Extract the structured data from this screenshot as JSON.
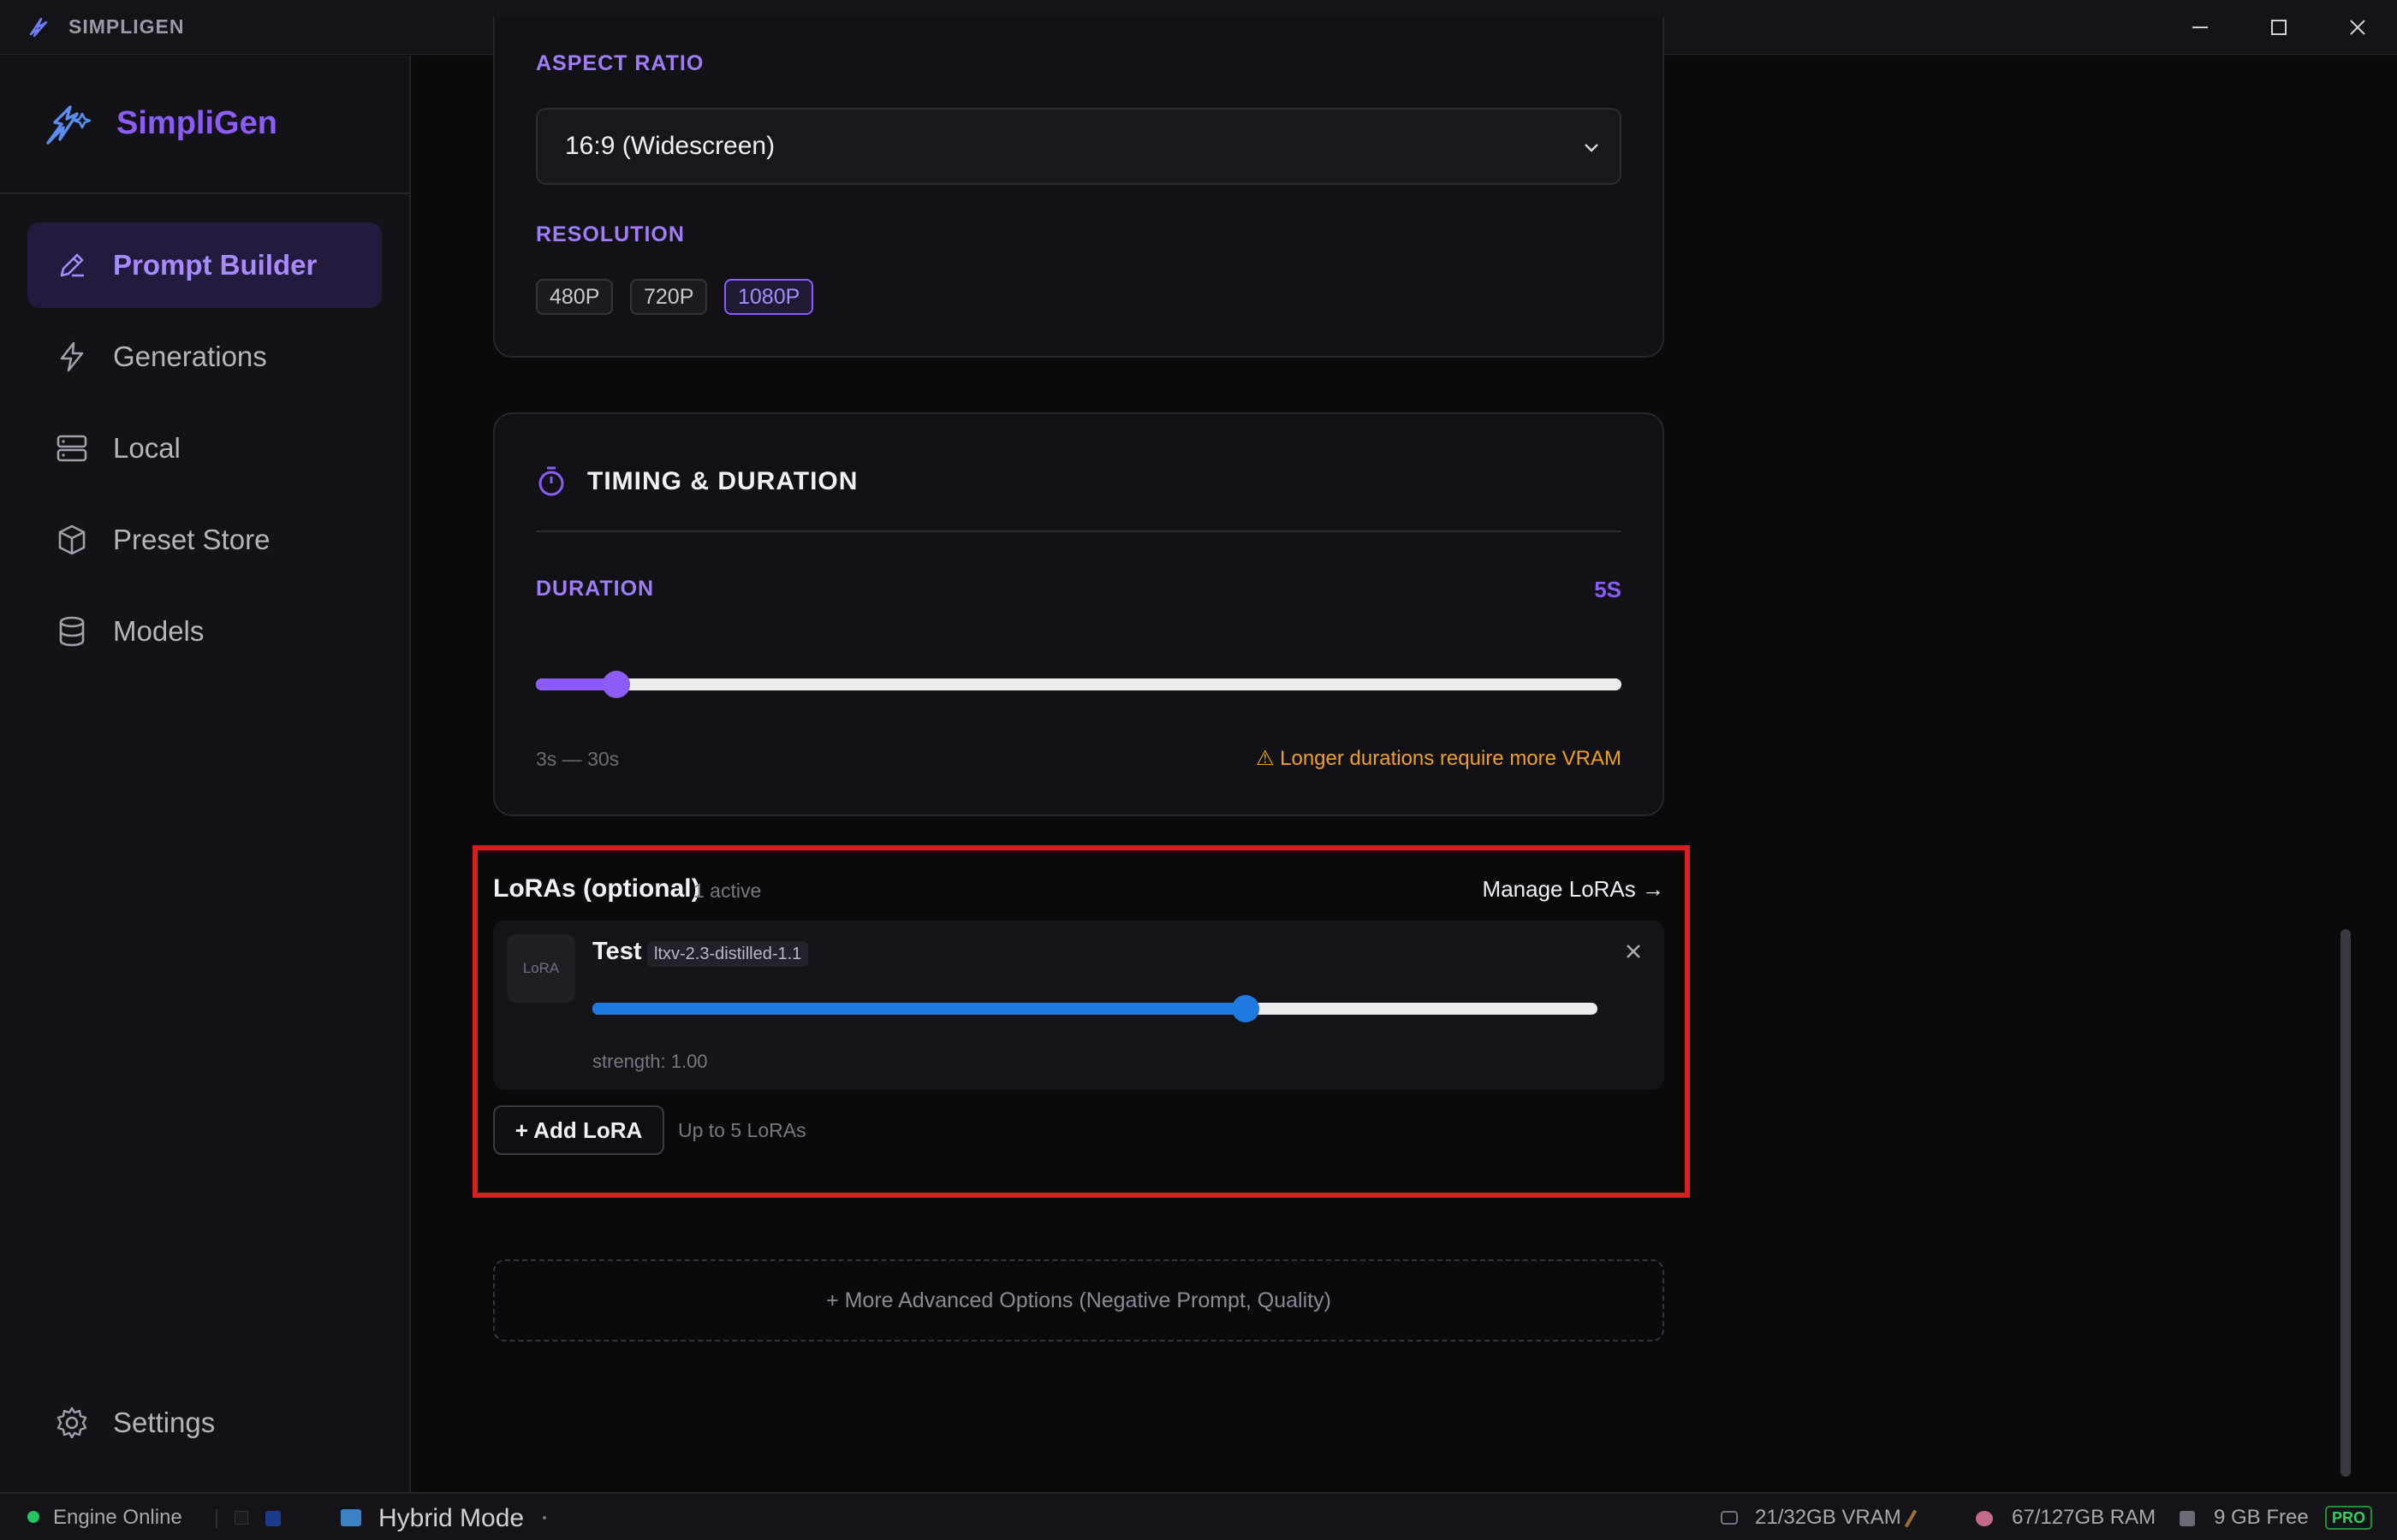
{
  "window": {
    "title": "SIMPLIGEN"
  },
  "sidebar": {
    "brand": "SimpliGen",
    "items": [
      {
        "label": "Prompt Builder",
        "icon": "pen-icon",
        "active": true
      },
      {
        "label": "Generations",
        "icon": "lightning-icon",
        "active": false
      },
      {
        "label": "Local",
        "icon": "server-icon",
        "active": false
      },
      {
        "label": "Preset Store",
        "icon": "box-icon",
        "active": false
      },
      {
        "label": "Models",
        "icon": "database-icon",
        "active": false
      }
    ],
    "settings_label": "Settings"
  },
  "format": {
    "aspect_ratio_label": "ASPECT RATIO",
    "aspect_ratio_value": "16:9 (Widescreen)",
    "resolution_label": "RESOLUTION",
    "resolutions": [
      "480P",
      "720P",
      "1080P"
    ],
    "selected_resolution": "1080P"
  },
  "timing": {
    "title": "TIMING & DURATION",
    "duration_label": "DURATION",
    "duration_value": "5S",
    "slider_fraction": 0.074,
    "range_note": "3s — 30s",
    "warning": "Longer durations require more VRAM"
  },
  "loras": {
    "title": "LoRAs (optional)",
    "count": "1 active",
    "manage_label": "Manage LoRAs →",
    "items": [
      {
        "thumb_label": "LoRA",
        "name": "Test",
        "model": "ltxv-2.3-distilled-1.1",
        "strength_fraction": 0.65,
        "strength_text": "strength: 1.00"
      }
    ],
    "add_label": "+ Add LoRA",
    "add_hint": "Up to 5 LoRAs"
  },
  "more_options": "+ More Advanced Options (Negative Prompt, Quality)",
  "status": {
    "engine": "Engine Online",
    "mode": "Hybrid Mode",
    "vram": "21/32GB VRAM",
    "ram": "67/127GB RAM",
    "disk": "9 GB Free",
    "plan": "PRO"
  },
  "colors": {
    "accent": "#8b5cf6",
    "lora_slider": "#1f7ae0",
    "warning": "#f0a020",
    "online": "#22c55e",
    "highlight": "#d81e1e"
  }
}
